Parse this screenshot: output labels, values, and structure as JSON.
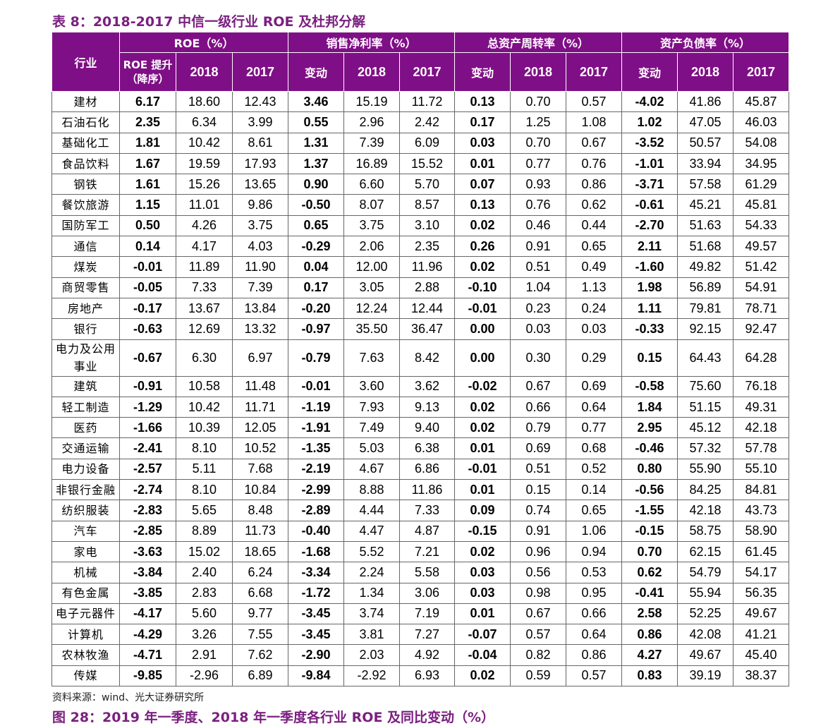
{
  "title": "表 8：2018-2017 中信一级行业 ROE 及杜邦分解",
  "header": {
    "industry": "行业",
    "groups": [
      "ROE（%）",
      "销售净利率（%）",
      "总资产周转率（%）",
      "资产负债率（%）"
    ],
    "roe_change": "ROE 提升（降序）",
    "change": "变动",
    "year1": "2018",
    "year2": "2017"
  },
  "rows": [
    [
      "建材",
      "6.17",
      "18.60",
      "12.43",
      "3.46",
      "15.19",
      "11.72",
      "0.13",
      "0.70",
      "0.57",
      "-4.02",
      "41.86",
      "45.87"
    ],
    [
      "石油石化",
      "2.35",
      "6.34",
      "3.99",
      "0.55",
      "2.96",
      "2.42",
      "0.17",
      "1.25",
      "1.08",
      "1.02",
      "47.05",
      "46.03"
    ],
    [
      "基础化工",
      "1.81",
      "10.42",
      "8.61",
      "1.31",
      "7.39",
      "6.09",
      "0.03",
      "0.70",
      "0.67",
      "-3.52",
      "50.57",
      "54.08"
    ],
    [
      "食品饮料",
      "1.67",
      "19.59",
      "17.93",
      "1.37",
      "16.89",
      "15.52",
      "0.01",
      "0.77",
      "0.76",
      "-1.01",
      "33.94",
      "34.95"
    ],
    [
      "钢铁",
      "1.61",
      "15.26",
      "13.65",
      "0.90",
      "6.60",
      "5.70",
      "0.07",
      "0.93",
      "0.86",
      "-3.71",
      "57.58",
      "61.29"
    ],
    [
      "餐饮旅游",
      "1.15",
      "11.01",
      "9.86",
      "-0.50",
      "8.07",
      "8.57",
      "0.13",
      "0.76",
      "0.62",
      "-0.61",
      "45.21",
      "45.81"
    ],
    [
      "国防军工",
      "0.50",
      "4.26",
      "3.75",
      "0.65",
      "3.75",
      "3.10",
      "0.02",
      "0.46",
      "0.44",
      "-2.70",
      "51.63",
      "54.33"
    ],
    [
      "通信",
      "0.14",
      "4.17",
      "4.03",
      "-0.29",
      "2.06",
      "2.35",
      "0.26",
      "0.91",
      "0.65",
      "2.11",
      "51.68",
      "49.57"
    ],
    [
      "煤炭",
      "-0.01",
      "11.89",
      "11.90",
      "0.04",
      "12.00",
      "11.96",
      "0.02",
      "0.51",
      "0.49",
      "-1.60",
      "49.82",
      "51.42"
    ],
    [
      "商贸零售",
      "-0.05",
      "7.33",
      "7.39",
      "0.17",
      "3.05",
      "2.88",
      "-0.10",
      "1.04",
      "1.13",
      "1.98",
      "56.89",
      "54.91"
    ],
    [
      "房地产",
      "-0.17",
      "13.67",
      "13.84",
      "-0.20",
      "12.24",
      "12.44",
      "-0.01",
      "0.23",
      "0.24",
      "1.11",
      "79.81",
      "78.71"
    ],
    [
      "银行",
      "-0.63",
      "12.69",
      "13.32",
      "-0.97",
      "35.50",
      "36.47",
      "0.00",
      "0.03",
      "0.03",
      "-0.33",
      "92.15",
      "92.47"
    ],
    [
      "电力及公用事业",
      "-0.67",
      "6.30",
      "6.97",
      "-0.79",
      "7.63",
      "8.42",
      "0.00",
      "0.30",
      "0.29",
      "0.15",
      "64.43",
      "64.28"
    ],
    [
      "建筑",
      "-0.91",
      "10.58",
      "11.48",
      "-0.01",
      "3.60",
      "3.62",
      "-0.02",
      "0.67",
      "0.69",
      "-0.58",
      "75.60",
      "76.18"
    ],
    [
      "轻工制造",
      "-1.29",
      "10.42",
      "11.71",
      "-1.19",
      "7.93",
      "9.13",
      "0.02",
      "0.66",
      "0.64",
      "1.84",
      "51.15",
      "49.31"
    ],
    [
      "医药",
      "-1.66",
      "10.39",
      "12.05",
      "-1.91",
      "7.49",
      "9.40",
      "0.02",
      "0.79",
      "0.77",
      "2.95",
      "45.12",
      "42.18"
    ],
    [
      "交通运输",
      "-2.41",
      "8.10",
      "10.52",
      "-1.35",
      "5.03",
      "6.38",
      "0.01",
      "0.69",
      "0.68",
      "-0.46",
      "57.32",
      "57.78"
    ],
    [
      "电力设备",
      "-2.57",
      "5.11",
      "7.68",
      "-2.19",
      "4.67",
      "6.86",
      "-0.01",
      "0.51",
      "0.52",
      "0.80",
      "55.90",
      "55.10"
    ],
    [
      "非银行金融",
      "-2.74",
      "8.10",
      "10.84",
      "-2.99",
      "8.88",
      "11.86",
      "0.01",
      "0.15",
      "0.14",
      "-0.56",
      "84.25",
      "84.81"
    ],
    [
      "纺织服装",
      "-2.83",
      "5.65",
      "8.48",
      "-2.89",
      "4.44",
      "7.33",
      "0.09",
      "0.74",
      "0.65",
      "-1.55",
      "42.18",
      "43.73"
    ],
    [
      "汽车",
      "-2.85",
      "8.89",
      "11.73",
      "-0.40",
      "4.47",
      "4.87",
      "-0.15",
      "0.91",
      "1.06",
      "-0.15",
      "58.75",
      "58.90"
    ],
    [
      "家电",
      "-3.63",
      "15.02",
      "18.65",
      "-1.68",
      "5.52",
      "7.21",
      "0.02",
      "0.96",
      "0.94",
      "0.70",
      "62.15",
      "61.45"
    ],
    [
      "机械",
      "-3.84",
      "2.40",
      "6.24",
      "-3.34",
      "2.24",
      "5.58",
      "0.03",
      "0.56",
      "0.53",
      "0.62",
      "54.79",
      "54.17"
    ],
    [
      "有色金属",
      "-3.85",
      "2.83",
      "6.68",
      "-1.72",
      "1.34",
      "3.06",
      "0.03",
      "0.98",
      "0.95",
      "-0.41",
      "55.94",
      "56.35"
    ],
    [
      "电子元器件",
      "-4.17",
      "5.60",
      "9.77",
      "-3.45",
      "3.74",
      "7.19",
      "0.01",
      "0.67",
      "0.66",
      "2.58",
      "52.25",
      "49.67"
    ],
    [
      "计算机",
      "-4.29",
      "3.26",
      "7.55",
      "-3.45",
      "3.81",
      "7.27",
      "-0.07",
      "0.57",
      "0.64",
      "0.86",
      "42.08",
      "41.21"
    ],
    [
      "农林牧渔",
      "-4.71",
      "2.91",
      "7.62",
      "-2.90",
      "2.03",
      "4.92",
      "-0.04",
      "0.82",
      "0.86",
      "4.27",
      "49.67",
      "45.40"
    ],
    [
      "传媒",
      "-9.85",
      "-2.96",
      "6.89",
      "-9.84",
      "-2.92",
      "6.93",
      "0.02",
      "0.59",
      "0.57",
      "0.83",
      "39.19",
      "38.37"
    ]
  ],
  "source": "资料来源：wind、光大证券研究所",
  "next_title": "图 28：2019 年一季度、2018 年一季度各行业 ROE 及同比变动（%）",
  "colors": {
    "header_bg": "#7f0f86",
    "title": "#7b1f80"
  }
}
